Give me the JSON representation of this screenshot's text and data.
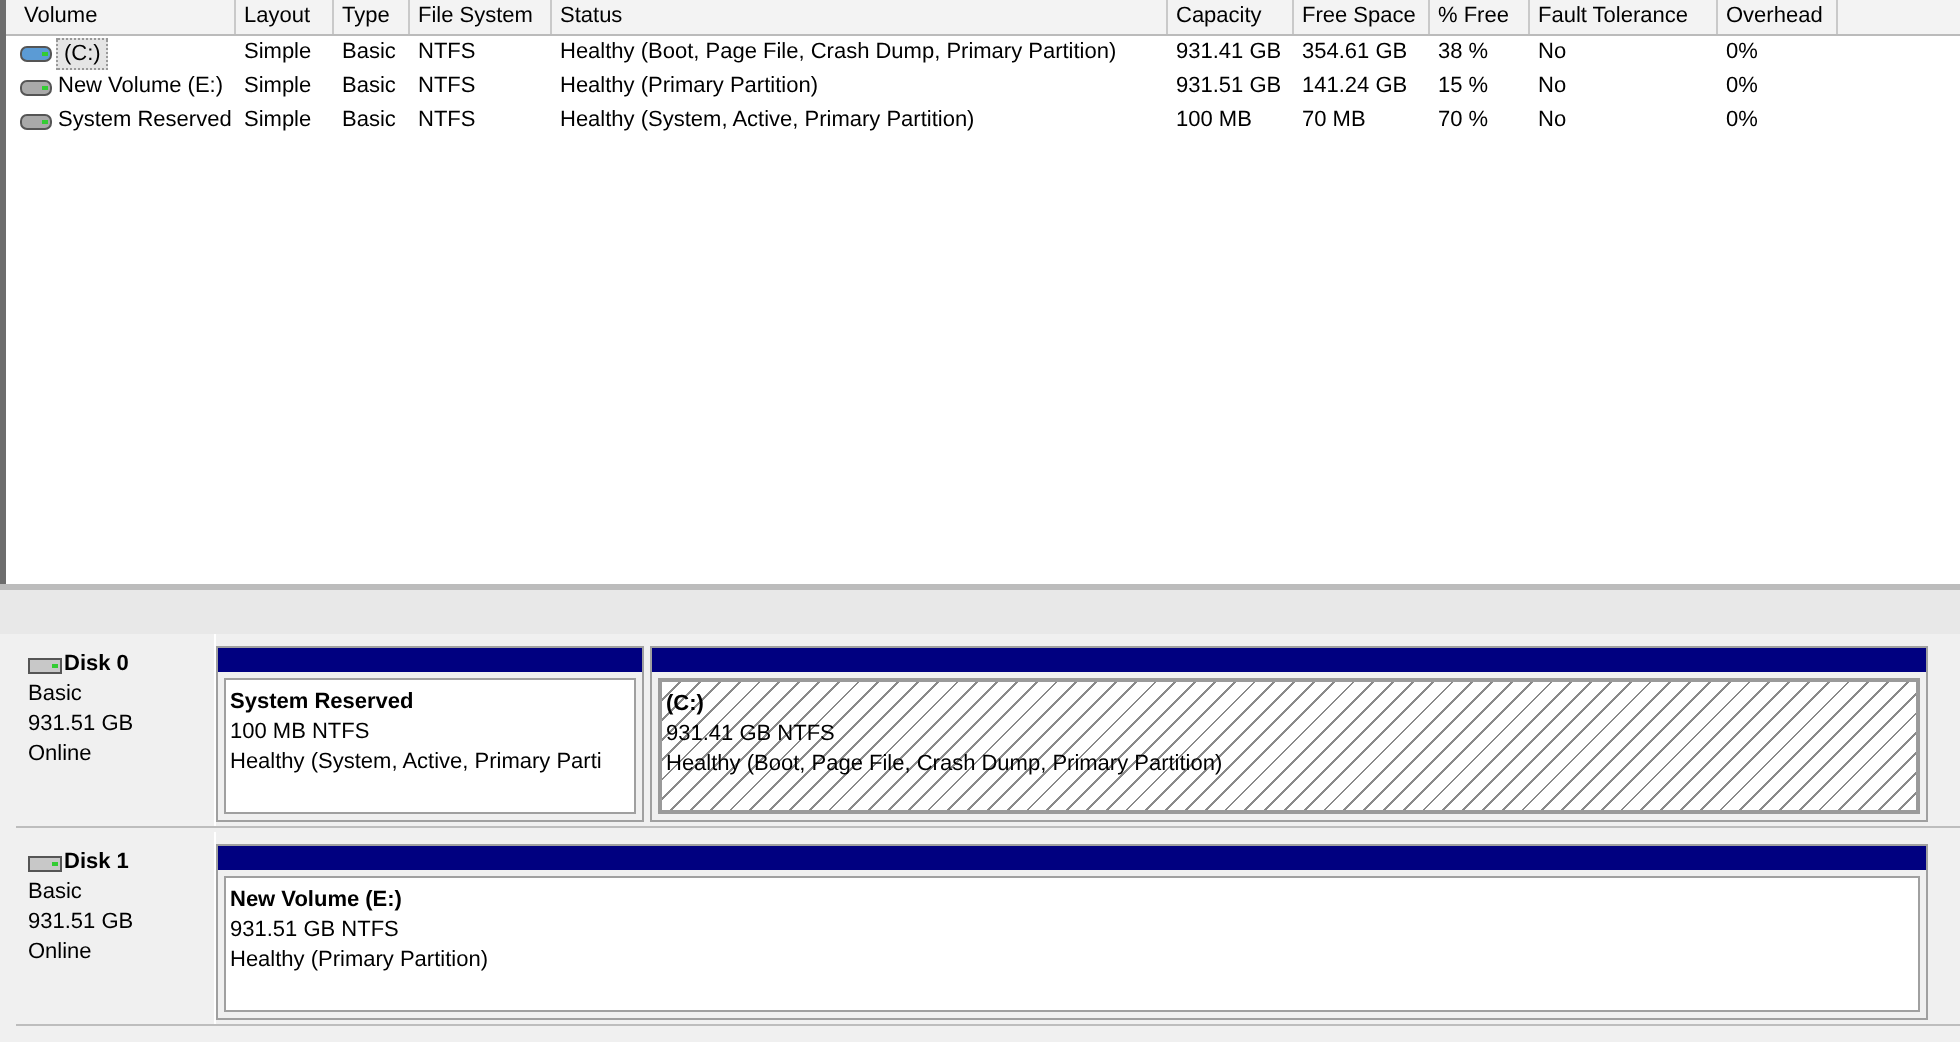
{
  "volume_list": {
    "columns": [
      "Volume",
      "Layout",
      "Type",
      "File System",
      "Status",
      "Capacity",
      "Free Space",
      "% Free",
      "Fault Tolerance",
      "Overhead"
    ],
    "rows": [
      {
        "boot": true,
        "selected": true,
        "cells": [
          "(C:)",
          "Simple",
          "Basic",
          "NTFS",
          "Healthy (Boot, Page File, Crash Dump, Primary Partition)",
          "931.41 GB",
          "354.61 GB",
          "38 %",
          "No",
          "0%"
        ]
      },
      {
        "boot": false,
        "selected": false,
        "cells": [
          "New Volume (E:)",
          "Simple",
          "Basic",
          "NTFS",
          "Healthy (Primary Partition)",
          "931.51 GB",
          "141.24 GB",
          "15 %",
          "No",
          "0%"
        ]
      },
      {
        "boot": false,
        "selected": false,
        "cells": [
          "System Reserved",
          "Simple",
          "Basic",
          "NTFS",
          "Healthy (System, Active, Primary Partition)",
          "100 MB",
          "70 MB",
          "70 %",
          "No",
          "0%"
        ]
      }
    ]
  },
  "disks": [
    {
      "name": "Disk 0",
      "type": "Basic",
      "size": "931.51 GB",
      "status": "Online",
      "partitions": [
        {
          "name": "System Reserved",
          "size": "100 MB NTFS",
          "status": "Healthy (System, Active, Primary Parti",
          "selected": false
        },
        {
          "name": "(C:)",
          "size": "931.41 GB NTFS",
          "status": "Healthy (Boot, Page File, Crash Dump, Primary Partition)",
          "selected": true
        }
      ]
    },
    {
      "name": "Disk 1",
      "type": "Basic",
      "size": "931.51 GB",
      "status": "Online",
      "partitions": [
        {
          "name": "New Volume  (E:)",
          "size": "931.51 GB NTFS",
          "status": "Healthy (Primary Partition)",
          "selected": false
        }
      ]
    }
  ]
}
